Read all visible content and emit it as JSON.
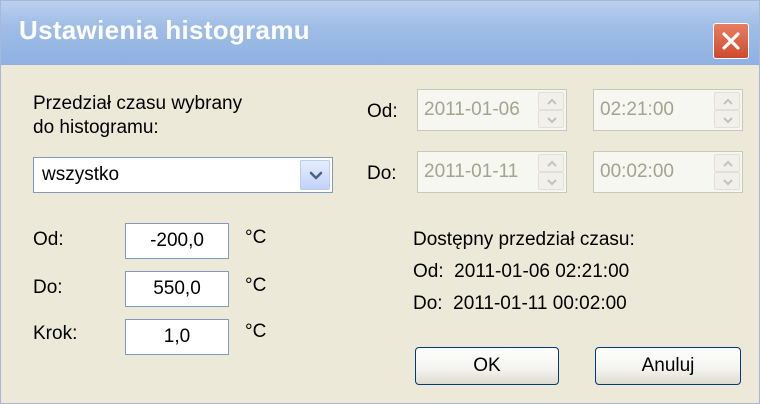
{
  "window": {
    "title": "Ustawienia histogramu"
  },
  "left": {
    "range_label_line1": "Przedział czasu wybrany",
    "range_label_line2": "do histogramu:",
    "range_select_value": "wszystko",
    "temp_from_label": "Od:",
    "temp_from_value": "-200,0",
    "temp_to_label": "Do:",
    "temp_to_value": "550,0",
    "step_label": "Krok:",
    "step_value": "1,0",
    "unit": "°C"
  },
  "right": {
    "from_label": "Od:",
    "from_date": "2011-01-06",
    "from_time": "02:21:00",
    "to_label": "Do:",
    "to_date": "2011-01-11",
    "to_time": "00:02:00",
    "available_heading": "Dostępny przedział czasu:",
    "available_from": "Od:  2011-01-06 02:21:00",
    "available_to": "Do:  2011-01-11 00:02:00"
  },
  "buttons": {
    "ok": "OK",
    "cancel": "Anuluj"
  },
  "icons": {
    "close": "close-icon",
    "dropdown": "chevron-down-icon",
    "spin_up": "spin-up-icon",
    "spin_down": "spin-down-icon"
  },
  "colors": {
    "titlebar": "#9fbde6",
    "close_button": "#d9573a",
    "dialog_background": "#ece9d8",
    "disabled_text": "#a3a38e"
  }
}
